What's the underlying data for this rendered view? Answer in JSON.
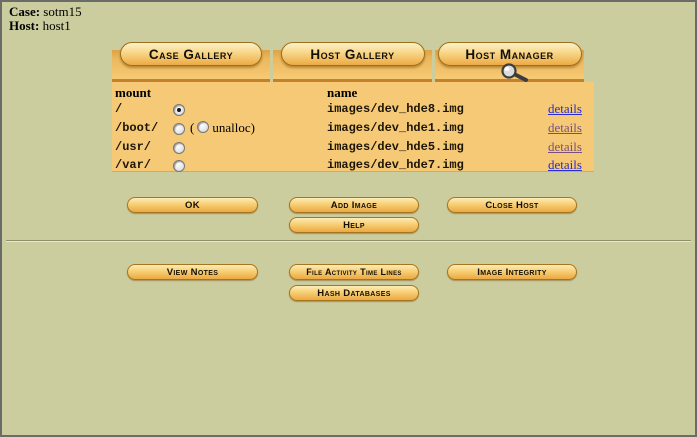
{
  "header": {
    "case_label": "Case:",
    "case_value": "sotm15",
    "host_label": "Host:",
    "host_value": "host1"
  },
  "tabs": [
    {
      "label": "Case Gallery"
    },
    {
      "label": "Host Gallery"
    },
    {
      "label": "Host Manager",
      "icon": "magnifier-icon",
      "active": true
    }
  ],
  "table": {
    "columns": {
      "mount": "mount",
      "name": "name"
    },
    "rows": [
      {
        "mount": "/",
        "selected": true,
        "name": "images/dev_hde8.img",
        "details": "details",
        "visited": false
      },
      {
        "mount": "/boot/",
        "selected": false,
        "unalloc_open": "(",
        "unalloc_label": "unalloc)",
        "name": "images/dev_hde1.img",
        "details": "details",
        "visited": true
      },
      {
        "mount": "/usr/",
        "selected": false,
        "name": "images/dev_hde5.img",
        "details": "details",
        "visited": true
      },
      {
        "mount": "/var/",
        "selected": false,
        "name": "images/dev_hde7.img",
        "details": "details",
        "visited": false
      }
    ]
  },
  "actions": {
    "ok": "OK",
    "add_image": "Add Image",
    "close_host": "Close Host",
    "help": "Help"
  },
  "tools": {
    "view_notes": "View Notes",
    "file_activity": "File Activity Time Lines",
    "image_integrity": "Image Integrity",
    "hash_databases": "Hash Databases"
  },
  "colors": {
    "page_bg": "#cbcd9f",
    "panel_gold": "#f5c975",
    "strip_border": "#c3812b",
    "button_face": "#f7cf74",
    "link": "#2b2bd0",
    "link_visited": "#7a5080"
  }
}
